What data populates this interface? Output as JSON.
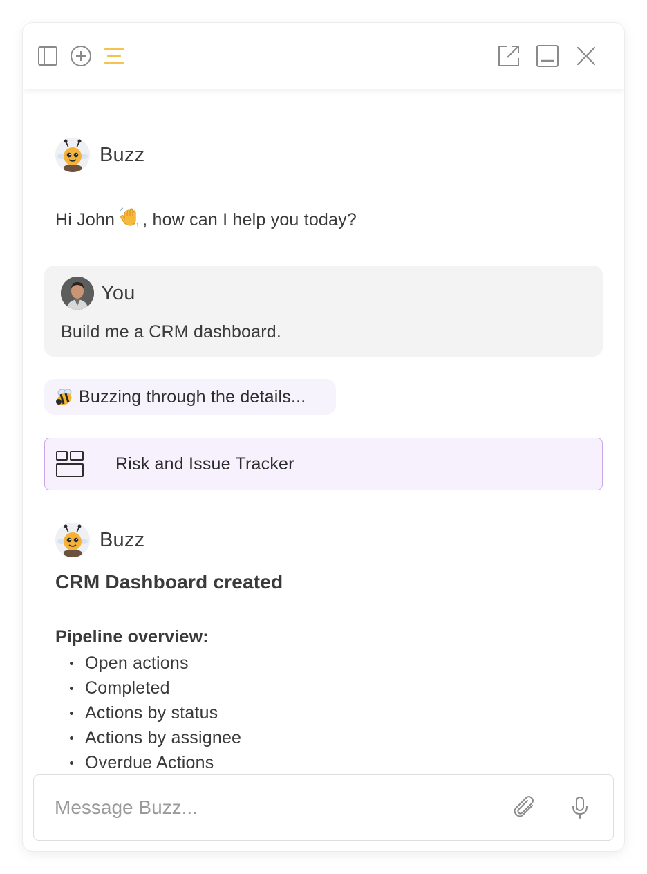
{
  "toolbar": {
    "left_icons": [
      "sidebar-toggle-icon",
      "new-chat-icon",
      "buzz-menu-icon"
    ],
    "right_icons": [
      "open-external-icon",
      "minimize-icon",
      "close-icon"
    ],
    "accent_color": "#f6c350"
  },
  "conversation": {
    "greeting": {
      "sender": "Buzz",
      "text_before": "Hi John",
      "emoji": "👋",
      "text_after": ", how can I help you today?"
    },
    "user_message": {
      "sender": "You",
      "text": "Build me a CRM dashboard."
    },
    "status": {
      "emoji": "🐝",
      "text": "Buzzing through the details..."
    },
    "artifact": {
      "icon": "dashboard-layout-icon",
      "label": "Risk and Issue Tracker"
    },
    "result": {
      "sender": "Buzz",
      "title": "CRM Dashboard created",
      "section_heading": "Pipeline overview:",
      "items": [
        "Open actions",
        "Completed",
        "Actions by status",
        "Actions by assignee",
        "Overdue Actions"
      ]
    }
  },
  "composer": {
    "placeholder": "Message Buzz...",
    "value": "",
    "attach_icon": "paperclip-icon",
    "voice_icon": "microphone-icon"
  },
  "colors": {
    "user_bubble": "#f3f3f3",
    "status_pill": "#f6f3fd",
    "artifact_bg": "#f6f1fd",
    "artifact_border": "#c8a7ec"
  }
}
